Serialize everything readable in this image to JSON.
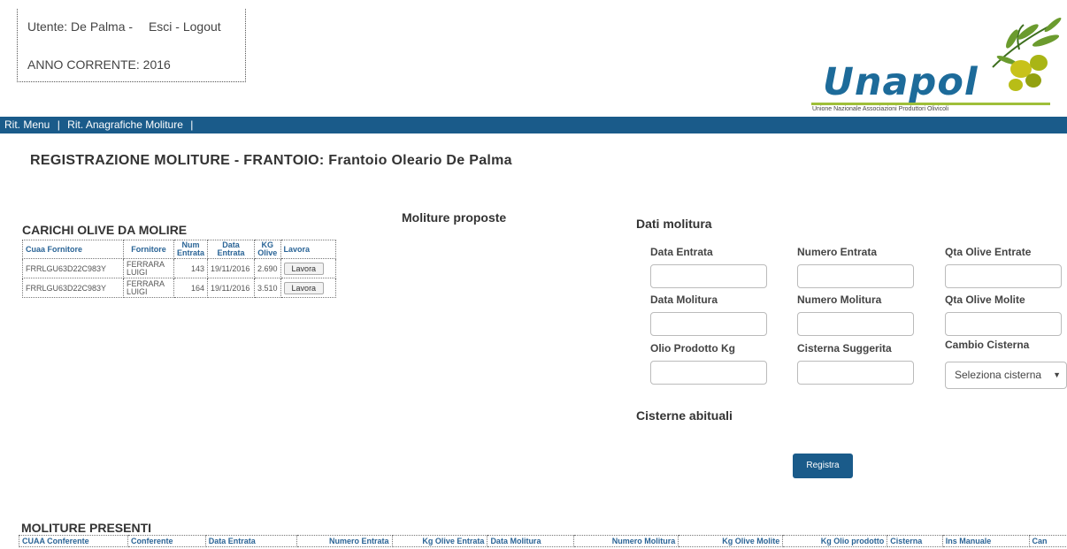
{
  "header": {
    "user_label": "Utente: De Palma -",
    "logout_label": "Esci - Logout",
    "year_label": "ANNO CORRENTE: 2016"
  },
  "logo": {
    "name": "Unapol",
    "subtitle": "Unione Nazionale Associazioni Produttori Olivicoli",
    "primary_color": "#1d6b9a",
    "accent_color": "#9fbf3a"
  },
  "nav": {
    "item1": "Rit. Menu",
    "item2": "Rit. Anagrafiche Moliture",
    "separator": "|"
  },
  "page_title": "REGISTRAZIONE MOLITURE - FRANTOIO: Frantoio Oleario De Palma",
  "carichi": {
    "title": "CARICHI OLIVE DA MOLIRE",
    "headers": [
      "Cuaa Fornitore",
      "Fornitore",
      "Num Entrata",
      "Data Entrata",
      "KG Olive",
      "Lavora"
    ],
    "rows": [
      {
        "cuaa": "FRRLGU63D22C983Y",
        "fornitore": "FERRARA LUIGI",
        "num": "143",
        "data": "19/11/2016",
        "kg": "2.690",
        "btn": "Lavora"
      },
      {
        "cuaa": "FRRLGU63D22C983Y",
        "fornitore": "FERRARA LUIGI",
        "num": "164",
        "data": "19/11/2016",
        "kg": "3.510",
        "btn": "Lavora"
      }
    ]
  },
  "proposte": {
    "title": "Moliture proposte"
  },
  "dati": {
    "title": "Dati molitura",
    "data_entrata": "Data Entrata",
    "numero_entrata": "Numero Entrata",
    "qta_olive_entrate": "Qta Olive Entrate",
    "data_molitura": "Data Molitura",
    "numero_molitura": "Numero Molitura",
    "qta_olive_molite": "Qta Olive Molite",
    "olio_prodotto": "Olio Prodotto Kg",
    "cisterna_suggerita": "Cisterna Suggerita",
    "cambio_cisterna": "Cambio Cisterna",
    "select_value": "Seleziona cisterna"
  },
  "cisterne": {
    "title": "Cisterne abituali"
  },
  "registra_label": "Registra",
  "presenti": {
    "title": "MOLITURE PRESENTI",
    "headers": [
      "CUAA Conferente",
      "Conferente",
      "Data Entrata",
      "Numero Entrata",
      "Kg Olive Entrata",
      "Data Molitura",
      "Numero Molitura",
      "Kg Olive Molite",
      "Kg Olio prodotto",
      "Cisterna",
      "Ins Manuale",
      "Can"
    ]
  }
}
